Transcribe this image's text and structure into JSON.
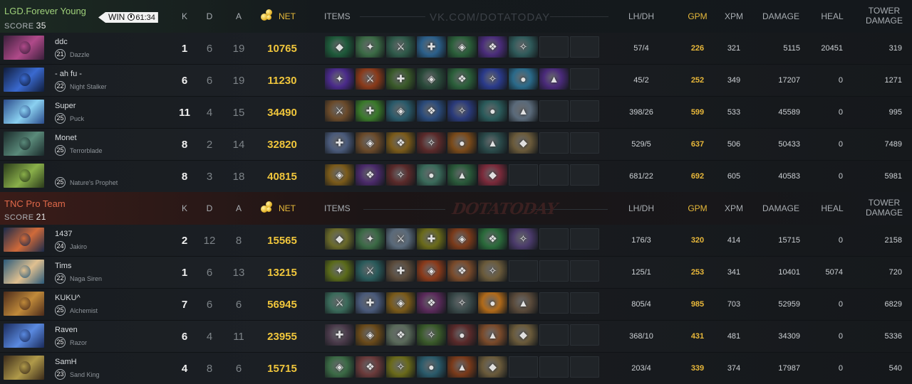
{
  "teams": [
    {
      "name": "LGD.Forever Young",
      "score_label": "SCORE",
      "score": "35",
      "badge": {
        "label": "WIN",
        "duration": "61:34"
      },
      "watermark": "VK.COM/DOTATODAY",
      "players": [
        {
          "name": "ddc",
          "level": "21",
          "hero": "Dazzle",
          "k": "1",
          "d": "6",
          "a": "19",
          "net": "10765",
          "lhdh": "57/4",
          "gpm": "226",
          "xpm": "321",
          "damage": "5115",
          "heal": "20451",
          "tower": "319",
          "portrait": [
            "#3a1f3a",
            "#b04a8a"
          ],
          "items": [
            "#1e5a3a",
            "#3b6a45",
            "#2f5a4a",
            "#2b5f8a",
            "#2b5f3a",
            "#4a2c7a",
            "#2f5a5a",
            "",
            ""
          ]
        },
        {
          "name": "- ah fu -",
          "level": "22",
          "hero": "Night Stalker",
          "k": "6",
          "d": "6",
          "a": "19",
          "net": "11230",
          "lhdh": "45/2",
          "gpm": "252",
          "xpm": "349",
          "damage": "17207",
          "heal": "0",
          "tower": "1271",
          "portrait": [
            "#101c3a",
            "#3a6ad0"
          ],
          "items": [
            "#4a2a8a",
            "#8a3a1a",
            "#3a5a2a",
            "#2a4a3a",
            "#2b5f3a",
            "#2a3a8a",
            "#2a6a8a",
            "#4a2a7a",
            ""
          ]
        },
        {
          "name": "Super",
          "level": "25",
          "hero": "Puck",
          "k": "11",
          "d": "4",
          "a": "15",
          "net": "34490",
          "lhdh": "398/26",
          "gpm": "599",
          "xpm": "533",
          "damage": "45589",
          "heal": "0",
          "tower": "995",
          "portrait": [
            "#2a4a8a",
            "#8ad0f0"
          ],
          "items": [
            "#6a4a2a",
            "#3a7a2a",
            "#2a5a6a",
            "#2a4a7a",
            "#2a3a7a",
            "#2a5a5a",
            "#5a6a7a",
            "",
            ""
          ]
        },
        {
          "name": "Monet",
          "level": "25",
          "hero": "Terrorblade",
          "k": "8",
          "d": "2",
          "a": "14",
          "net": "32820",
          "lhdh": "529/5",
          "gpm": "637",
          "xpm": "506",
          "damage": "50433",
          "heal": "0",
          "tower": "7489",
          "portrait": [
            "#1a2a2a",
            "#5a8a7a"
          ],
          "items": [
            "#4a5a7a",
            "#6a4a2a",
            "#7a5a1a",
            "#5a2a2a",
            "#7a4a1a",
            "#2a4a4a",
            "#6a5a3a",
            "",
            ""
          ]
        },
        {
          "name": "",
          "level": "25",
          "hero": "Nature's Prophet",
          "k": "8",
          "d": "3",
          "a": "18",
          "net": "40815",
          "lhdh": "681/22",
          "gpm": "692",
          "xpm": "605",
          "damage": "40583",
          "heal": "0",
          "tower": "5981",
          "portrait": [
            "#2a3a1a",
            "#8ab04a"
          ],
          "items": [
            "#7a5a1a",
            "#4a2a6a",
            "#5a2a2a",
            "#3a6a5a",
            "#2a5a3a",
            "#7a2a3a",
            "",
            "",
            ""
          ]
        }
      ]
    },
    {
      "name": "TNC Pro Team",
      "score_label": "SCORE",
      "score": "21",
      "watermark": "DOTATODAY",
      "players": [
        {
          "name": "1437",
          "level": "24",
          "hero": "Jakiro",
          "k": "2",
          "d": "12",
          "a": "8",
          "net": "15565",
          "lhdh": "176/3",
          "gpm": "320",
          "xpm": "414",
          "damage": "15715",
          "heal": "0",
          "tower": "2158",
          "portrait": [
            "#1a2a4a",
            "#d06a3a"
          ],
          "items": [
            "#6a6a2a",
            "#3b6a45",
            "#5a6a7a",
            "#6a6a1a",
            "#7a3a1a",
            "#2a6a3a",
            "#4a3a6a",
            "",
            ""
          ]
        },
        {
          "name": "Tims",
          "level": "22",
          "hero": "Naga Siren",
          "k": "1",
          "d": "6",
          "a": "13",
          "net": "13215",
          "lhdh": "125/1",
          "gpm": "253",
          "xpm": "341",
          "damage": "10401",
          "heal": "5074",
          "tower": "720",
          "portrait": [
            "#2a5a7a",
            "#e0c090"
          ],
          "items": [
            "#5a6a1a",
            "#2a5a5a",
            "#5a4a3a",
            "#8a3a1a",
            "#7a4a2a",
            "#6a5a3a",
            "",
            "",
            ""
          ]
        },
        {
          "name": "KUKU^",
          "level": "25",
          "hero": "Alchemist",
          "k": "7",
          "d": "6",
          "a": "6",
          "net": "56945",
          "lhdh": "805/4",
          "gpm": "985",
          "xpm": "703",
          "damage": "52959",
          "heal": "0",
          "tower": "6829",
          "portrait": [
            "#4a2a1a",
            "#c08a3a"
          ],
          "items": [
            "#3a6a5a",
            "#4a5a7a",
            "#7a5a1a",
            "#5a2a5a",
            "#3a4a4a",
            "#b06a1a",
            "#5a4a3a",
            "",
            ""
          ]
        },
        {
          "name": "Raven",
          "level": "25",
          "hero": "Razor",
          "k": "6",
          "d": "4",
          "a": "11",
          "net": "23955",
          "lhdh": "368/10",
          "gpm": "431",
          "xpm": "481",
          "damage": "34309",
          "heal": "0",
          "tower": "5336",
          "portrait": [
            "#1a2a5a",
            "#5a8ae0"
          ],
          "items": [
            "#4a3a4a",
            "#6a4a1a",
            "#5a6a5a",
            "#3a5a2a",
            "#5a2a2a",
            "#7a4a2a",
            "#6a5a3a",
            "",
            ""
          ]
        },
        {
          "name": "SamH",
          "level": "23",
          "hero": "Sand King",
          "k": "4",
          "d": "8",
          "a": "6",
          "net": "15715",
          "lhdh": "203/4",
          "gpm": "339",
          "xpm": "374",
          "damage": "17987",
          "heal": "0",
          "tower": "540",
          "portrait": [
            "#3a2a1a",
            "#b09a4a"
          ],
          "items": [
            "#3b6a45",
            "#6a3a3a",
            "#6a6a1a",
            "#2a5a6a",
            "#7a3a1a",
            "#6a5a3a",
            "",
            "",
            ""
          ]
        }
      ]
    }
  ],
  "columns": {
    "k": "K",
    "d": "D",
    "a": "A",
    "net": "NET",
    "items": "ITEMS",
    "lhdh": "LH/DH",
    "gpm": "GPM",
    "xpm": "XPM",
    "damage": "DAMAGE",
    "heal": "HEAL",
    "tower_line1": "TOWER",
    "tower_line2": "DAMAGE"
  }
}
